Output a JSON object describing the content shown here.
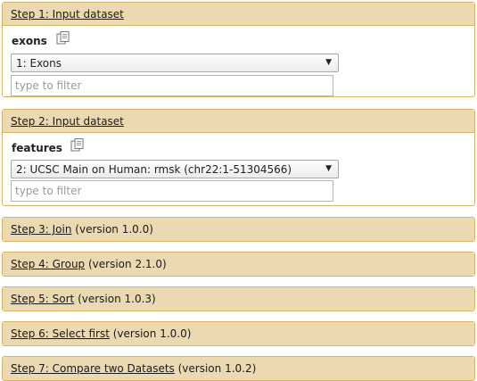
{
  "steps": [
    {
      "title": "Step 1: Input dataset",
      "param_label": "exons",
      "selected": "1: Exons",
      "filter_placeholder": "type to filter"
    },
    {
      "title": "Step 2: Input dataset",
      "param_label": "features",
      "selected": "2: UCSC Main on Human: rmsk (chr22:1-51304566)",
      "filter_placeholder": "type to filter"
    },
    {
      "title": "Step 3: Join",
      "version": "(version 1.0.0)"
    },
    {
      "title": "Step 4: Group",
      "version": "(version 2.1.0)"
    },
    {
      "title": "Step 5: Sort",
      "version": "(version 1.0.3)"
    },
    {
      "title": "Step 6: Select first",
      "version": "(version 1.0.0)"
    },
    {
      "title": "Step 7: Compare two Datasets",
      "version": "(version 1.0.2)"
    }
  ],
  "icons": {
    "copy": "copy-datasets-icon",
    "dropdown": "chevron-down-icon"
  },
  "colors": {
    "header_bg": "#ebd9b2",
    "border": "#d8b365"
  }
}
